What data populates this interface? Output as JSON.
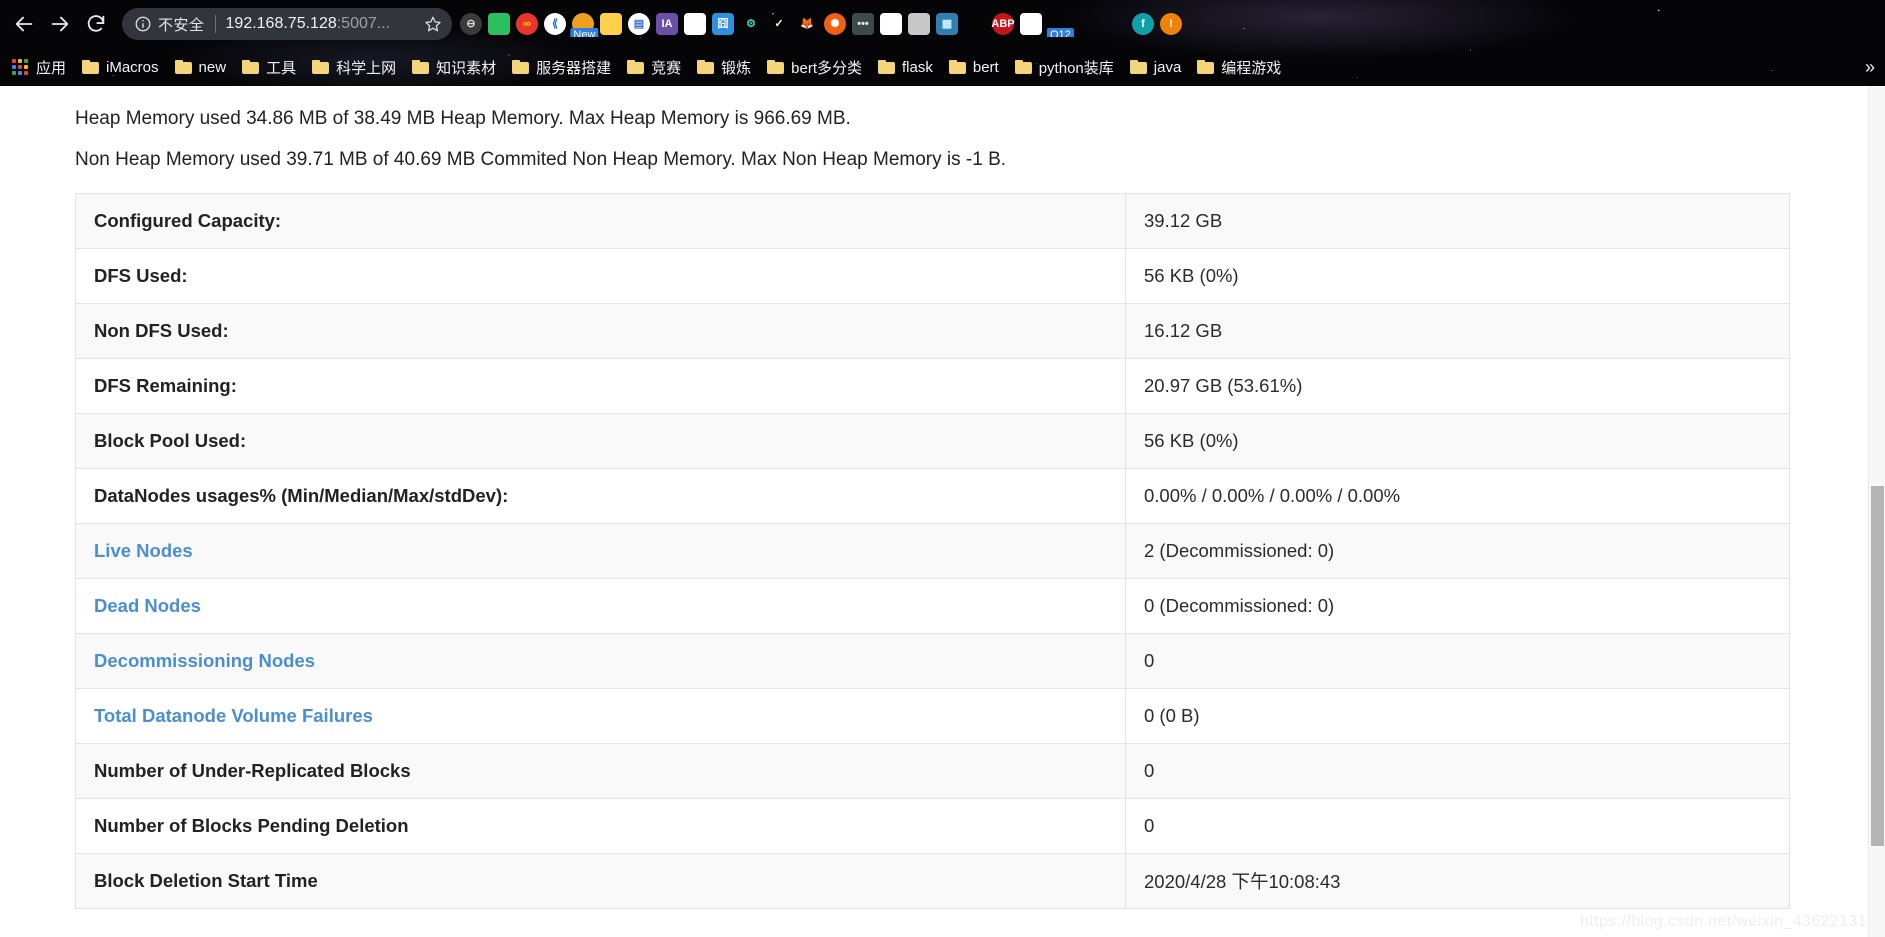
{
  "browser": {
    "nav": {
      "back_icon": "arrow-left-icon",
      "forward_icon": "arrow-right-icon",
      "reload_icon": "reload-icon"
    },
    "omnibox": {
      "security_icon": "info-circle-icon",
      "security_label": "不安全",
      "url_visible": "192.168.75.128",
      "url_dim": ":5007...",
      "star_icon": "star-icon"
    },
    "extensions": [
      {
        "name": "adblock-minus-icon",
        "glyph": "⊖",
        "bg": "#3b3b3b",
        "fg": "#dcdcdc",
        "shape": "ci"
      },
      {
        "name": "evernote-icon",
        "glyph": "",
        "bg": "#2dbe60",
        "fg": "#ffffff",
        "shape": "sq"
      },
      {
        "name": "infinity-icon",
        "glyph": "∞",
        "bg": "#e8352e",
        "fg": "#ffd400",
        "shape": "ci"
      },
      {
        "name": "chevrons-left-icon",
        "glyph": "⟪",
        "bg": "#ffffff",
        "fg": "#2f6fd0",
        "shape": "ci"
      },
      {
        "name": "camera-new-icon",
        "glyph": "",
        "bg": "#f0a020",
        "fg": "#ffffff",
        "shape": "ci",
        "badge": "New"
      },
      {
        "name": "google-keep-icon",
        "glyph": "",
        "bg": "#ffd04a",
        "fg": "#333333",
        "shape": "sq"
      },
      {
        "name": "reader-list-icon",
        "glyph": "▤",
        "bg": "#ffffff",
        "fg": "#3a6fd8",
        "shape": "ci"
      },
      {
        "name": "instapaper-ia-icon",
        "glyph": "IA",
        "bg": "#6b4fa8",
        "fg": "#ffffff",
        "shape": "sq"
      },
      {
        "name": "baidu-cloud-icon",
        "glyph": "",
        "bg": "#ffffff",
        "fg": "#2f7fe0",
        "shape": "sq"
      },
      {
        "name": "translate-icon",
        "glyph": "囧",
        "bg": "#2f8fe0",
        "fg": "#ffffff",
        "shape": "sq"
      },
      {
        "name": "gear-teal-icon",
        "glyph": "⚙",
        "bg": "transparent",
        "fg": "#30d0c0",
        "shape": "sq"
      },
      {
        "name": "checkmark-icon",
        "glyph": "✓",
        "bg": "transparent",
        "fg": "#ffffff",
        "shape": "sq"
      },
      {
        "name": "fox-icon",
        "glyph": "🦊",
        "bg": "transparent",
        "fg": "#e08020",
        "shape": "sq"
      },
      {
        "name": "lifebuoy-orange-icon",
        "glyph": "✺",
        "bg": "#f06010",
        "fg": "#ffffff",
        "shape": "ci"
      },
      {
        "name": "more-dots-icon",
        "glyph": "•••",
        "bg": "#3d4a4a",
        "fg": "#e6e6e6",
        "shape": "sq"
      },
      {
        "name": "panda-icon",
        "glyph": "",
        "bg": "#ffffff",
        "fg": "#101010",
        "shape": "sq"
      },
      {
        "name": "yin-yang-icon",
        "glyph": "",
        "bg": "#c8c8c8",
        "fg": "#1a1a1a",
        "shape": "sq"
      },
      {
        "name": "city-blue-icon",
        "glyph": "▦",
        "bg": "#2f7fb0",
        "fg": "#d0f0ff",
        "shape": "sq"
      },
      {
        "name": "paw-blocked-icon",
        "glyph": "",
        "bg": "transparent",
        "fg": "#2b4fd0",
        "shape": "sq"
      },
      {
        "name": "adblock-plus-icon",
        "glyph": "ABP",
        "bg": "#c4161c",
        "fg": "#ffffff",
        "shape": "ci"
      },
      {
        "name": "bluebird-icon",
        "glyph": "",
        "bg": "#ffffff",
        "fg": "#4a9ff0",
        "shape": "sq"
      },
      {
        "name": "hat-o12-icon",
        "glyph": "",
        "bg": "transparent",
        "fg": "#d8d8d8",
        "shape": "sq",
        "badge": "O12"
      },
      {
        "name": "aria-download-icon",
        "glyph": "",
        "bg": "transparent",
        "fg": "#e0e0e0",
        "shape": "sq"
      },
      {
        "name": "cloud-gray-icon",
        "glyph": "",
        "bg": "transparent",
        "fg": "#cfcfcf",
        "shape": "sq"
      },
      {
        "name": "facebook-icon",
        "glyph": "f",
        "bg": "#10a0a8",
        "fg": "#ffffff",
        "shape": "ci"
      },
      {
        "name": "alert-orange-icon",
        "glyph": "!",
        "bg": "#f0820a",
        "fg": "#ffffff",
        "shape": "ci"
      }
    ],
    "bookmarks": {
      "apps_label": "应用",
      "items": [
        {
          "label": "iMacros"
        },
        {
          "label": "new"
        },
        {
          "label": "工具"
        },
        {
          "label": "科学上网"
        },
        {
          "label": "知识素材"
        },
        {
          "label": "服务器搭建"
        },
        {
          "label": "竞赛"
        },
        {
          "label": "锻炼"
        },
        {
          "label": "bert多分类"
        },
        {
          "label": "flask"
        },
        {
          "label": "bert"
        },
        {
          "label": "python装库"
        },
        {
          "label": "java"
        },
        {
          "label": "编程游戏"
        }
      ],
      "overflow_glyph": "»"
    }
  },
  "page": {
    "heap_memory_line": "Heap Memory used 34.86 MB of 38.49 MB Heap Memory. Max Heap Memory is 966.69 MB.",
    "non_heap_memory_line": "Non Heap Memory used 39.71 MB of 40.69 MB Commited Non Heap Memory. Max Non Heap Memory is -1 B.",
    "summary_rows": [
      {
        "key": "Configured Capacity:",
        "value": "39.12 GB",
        "link": false
      },
      {
        "key": "DFS Used:",
        "value": "56 KB (0%)",
        "link": false
      },
      {
        "key": "Non DFS Used:",
        "value": "16.12 GB",
        "link": false
      },
      {
        "key": "DFS Remaining:",
        "value": "20.97 GB (53.61%)",
        "link": false
      },
      {
        "key": "Block Pool Used:",
        "value": "56 KB (0%)",
        "link": false
      },
      {
        "key": "DataNodes usages% (Min/Median/Max/stdDev):",
        "value": "0.00% / 0.00% / 0.00% / 0.00%",
        "link": false
      },
      {
        "key": "Live Nodes",
        "value": "2 (Decommissioned: 0)",
        "link": true
      },
      {
        "key": "Dead Nodes",
        "value": "0 (Decommissioned: 0)",
        "link": true
      },
      {
        "key": "Decommissioning Nodes",
        "value": "0",
        "link": true
      },
      {
        "key": "Total Datanode Volume Failures",
        "value": "0 (0 B)",
        "link": true
      },
      {
        "key": "Number of Under-Replicated Blocks",
        "value": "0",
        "link": false
      },
      {
        "key": "Number of Blocks Pending Deletion",
        "value": "0",
        "link": false
      },
      {
        "key": "Block Deletion Start Time",
        "value": "2020/4/28 下午10:08:43",
        "link": false
      }
    ],
    "watermark": "https://blog.csdn.net/weixin_43622131",
    "link_color": "#4a8fd4"
  }
}
